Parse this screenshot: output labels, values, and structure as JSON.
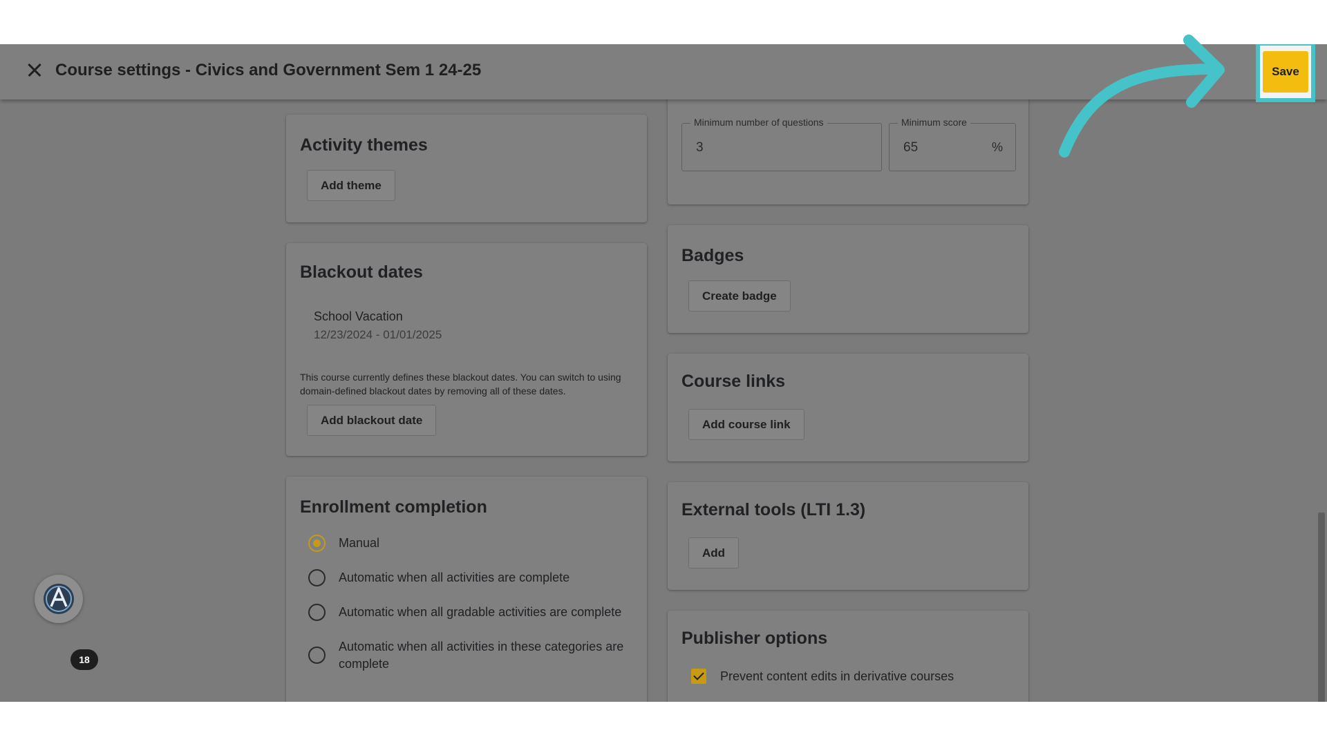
{
  "header": {
    "title": "Course settings - Civics and Government Sem 1 24-25",
    "save_label": "Save"
  },
  "activity_themes": {
    "title": "Activity themes",
    "add_button": "Add theme"
  },
  "blackout_dates": {
    "title": "Blackout dates",
    "entry_name": "School Vacation",
    "entry_range": "12/23/2024 - 01/01/2025",
    "note": "This course currently defines these blackout dates. You can switch to using domain-defined blackout dates by removing all of these dates.",
    "add_button": "Add blackout date"
  },
  "enrollment_completion": {
    "title": "Enrollment completion",
    "options": [
      "Manual",
      "Automatic when all activities are complete",
      "Automatic when all gradable activities are complete",
      "Automatic when all activities in these categories are complete"
    ],
    "selected": "Manual"
  },
  "mastery": {
    "min_questions_label": "Minimum number of questions",
    "min_questions_value": "3",
    "min_score_label": "Minimum score",
    "min_score_value": "65",
    "min_score_suffix": "%"
  },
  "badges": {
    "title": "Badges",
    "create_button": "Create badge"
  },
  "course_links": {
    "title": "Course links",
    "add_button": "Add course link"
  },
  "external_tools": {
    "title": "External tools (LTI 1.3)",
    "add_button": "Add"
  },
  "publisher_options": {
    "title": "Publisher options",
    "prevent_edits_label": "Prevent content edits in derivative courses",
    "prevent_edits_checked": true
  },
  "notifications": {
    "count": "18"
  },
  "colors": {
    "accent": "#f2bd0f",
    "highlight": "#45c3c9",
    "overlay": "#808080"
  }
}
